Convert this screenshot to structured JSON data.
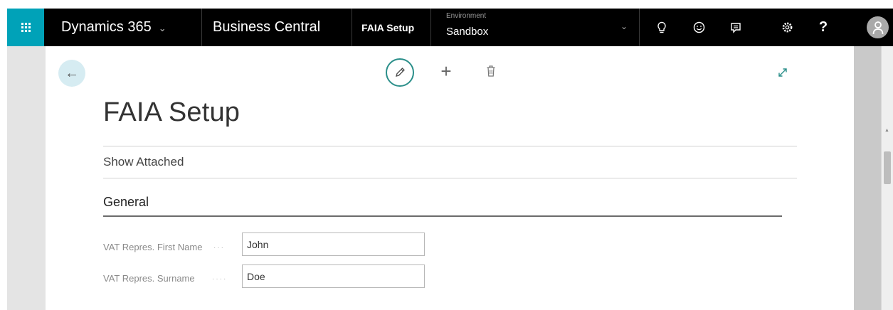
{
  "topbar": {
    "product": "Dynamics 365",
    "app": "Business Central",
    "page": "FAIA Setup",
    "environment": {
      "label": "Environment",
      "value": "Sandbox"
    },
    "icons": [
      "waffle-icon",
      "lightbulb-icon",
      "smiley-icon",
      "feedback-icon",
      "settings-icon",
      "help-icon",
      "avatar-icon"
    ],
    "colors": {
      "bar": "#000000",
      "waffle": "#00a2b8"
    }
  },
  "actions": {
    "icons": [
      "back-arrow-icon",
      "edit-icon",
      "new-icon",
      "delete-icon",
      "expand-icon"
    ],
    "accent": "#2b8f8a"
  },
  "page": {
    "title": "FAIA Setup",
    "show_attached": "Show Attached",
    "section": "General",
    "fields": [
      {
        "label": "VAT Repres. First Name",
        "value": "John"
      },
      {
        "label": "VAT Repres. Surname",
        "value": "Doe"
      }
    ]
  }
}
